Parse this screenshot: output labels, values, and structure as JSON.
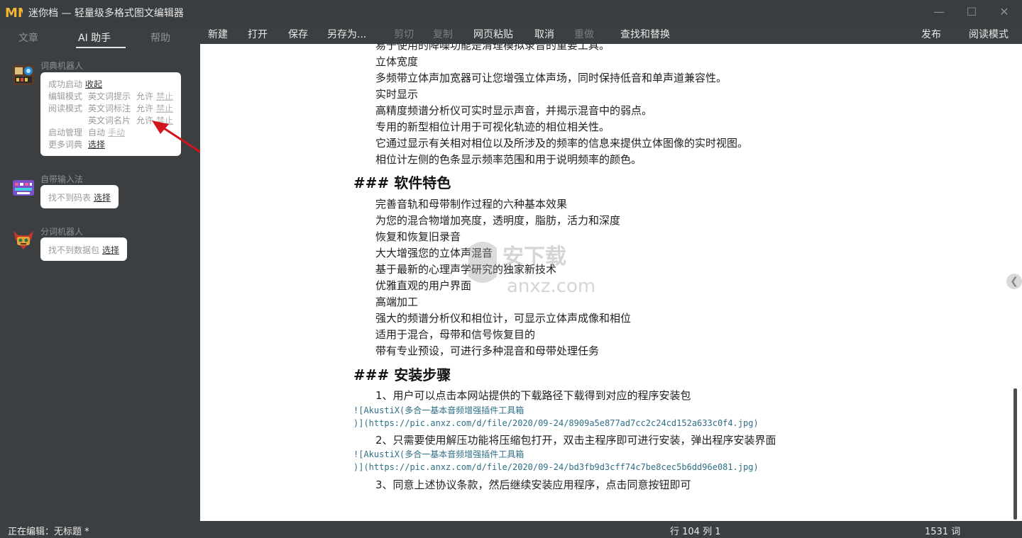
{
  "window": {
    "title": "迷你档 — 轻量级多格式图文编辑器",
    "logo_text": "MN"
  },
  "sidebar": {
    "tabs": [
      {
        "label": "文章"
      },
      {
        "label": "AI 助手"
      },
      {
        "label": "帮助"
      }
    ],
    "dict_bot": {
      "title": "词典机器人",
      "startup_label": "成功启动",
      "startup_action": "收起",
      "edit_mode_label": "编辑模式",
      "edit_mode_feature": "英文词提示",
      "read_mode_label": "阅读模式",
      "read_mode_feature": "英文词标注",
      "card_feature": "英文词名片",
      "allow": "允许",
      "forbid": "禁止",
      "launch_label": "启动管理",
      "launch_auto": "自动",
      "launch_manual": "手动",
      "more_dict_label": "更多词典",
      "more_dict_action": "选择"
    },
    "ime": {
      "title": "自带输入法",
      "message": "找不到码表",
      "action": "选择"
    },
    "seg_bot": {
      "title": "分词机器人",
      "message": "找不到数据包",
      "action": "选择"
    }
  },
  "toolbar": {
    "new": "新建",
    "open": "打开",
    "save": "保存",
    "save_as": "另存为...",
    "cut": "剪切",
    "copy": "复制",
    "web_paste": "网页粘贴",
    "undo": "取消",
    "redo": "重做",
    "find_replace": "查找和替换",
    "publish": "发布",
    "reading_mode": "阅读模式"
  },
  "editor": {
    "lines": [
      "易于使用的降噪功能是清理模拟录音的重要工具。",
      "立体宽度",
      "多频带立体声加宽器可让您增强立体声场，同时保持低音和单声道兼容性。",
      "实时显示",
      "高精度频谱分析仪可实时显示声音，并揭示混音中的弱点。",
      "专用的新型相位计用于可视化轨迹的相位相关性。",
      "它通过显示有关相对相位以及所涉及的频率的信息来提供立体图像的实时视图。",
      "相位计左侧的色条显示频率范围和用于说明频率的颜色。"
    ],
    "heading1": "### 软件特色",
    "features": [
      "完善音轨和母带制作过程的六种基本效果",
      "为您的混合物增加亮度，透明度，脂肪，活力和深度",
      "恢复和恢复旧录音",
      "大大增强您的立体声混音",
      "基于最新的心理声学研究的独家新技术",
      "优雅直观的用户界面",
      "高端加工",
      "强大的频谱分析仪和相位计，可显示立体声成像和相位",
      "适用于混合，母带和信号恢复目的",
      "带有专业预设，可进行多种混音和母带处理任务"
    ],
    "heading2": "### 安装步骤",
    "step1": "1、用户可以点击本网站提供的下载路径下载得到对应的程序安装包",
    "img1_a": "![AkustiX(多合一基本音频增强插件工具箱",
    "img1_b": ")](https://pic.anxz.com/d/file/2020/09-24/8909a5e877ad7cc2c24cd152a633c0f4.jpg)",
    "step2": "2、只需要使用解压功能将压缩包打开，双击主程序即可进行安装，弹出程序安装界面",
    "img2_a": "![AkustiX(多合一基本音频增强插件工具箱",
    "img2_b": ")](https://pic.anxz.com/d/file/2020/09-24/bd3fb9d3cff74c7be8cec5b6dd96e081.jpg)",
    "step3": "3、同意上述协议条款，然后继续安装应用程序，点击同意按钮即可"
  },
  "watermark": {
    "text": "安下载",
    "url": "anxz.com"
  },
  "statusbar": {
    "editing": "正在编辑：无标题 *",
    "position": "行 104 列 1",
    "words": "1531 词"
  },
  "colors": {
    "chrome": "#3c3f41",
    "editor_bg": "#ffffff",
    "code_text": "#2e6f86",
    "annotation_arrow": "#d0161c"
  }
}
